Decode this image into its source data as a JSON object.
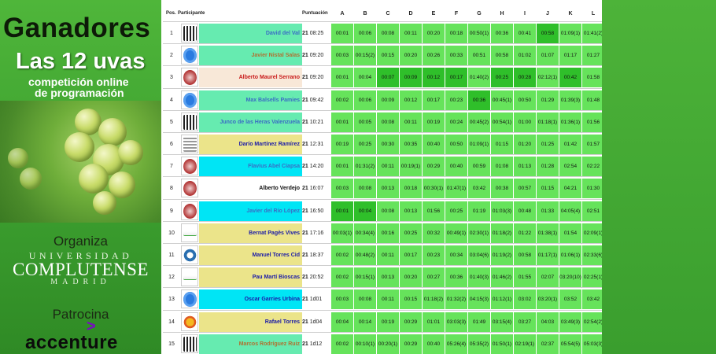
{
  "banner": {
    "title_line1": "Ganadores",
    "title_line2": "Las 12 uvas",
    "subtitle_line1": "competición online",
    "subtitle_line2": "de programación",
    "organiza_label": "Organiza",
    "university_line1": "UNIVERSIDAD",
    "university_line2": "COMPLUTENSE",
    "university_line3": "MADRID",
    "patrocina_label": "Patrocina",
    "sponsor_chevron": ">",
    "sponsor_name": "accenture"
  },
  "colors": {
    "banner_green": "#3c9f2f",
    "cell_green": "#66e35b",
    "cell_dark_green": "#2fbf2a",
    "row_cyan": "#00e5f5",
    "row_yellow": "#ebe48a",
    "row_mint": "#66ebb0",
    "row_peach": "#f8e8d8",
    "accent_purple": "#7a0ac6"
  },
  "table": {
    "headers": {
      "pos": "Pos.",
      "participante": "Participante",
      "puntuacion": "Puntuación",
      "problems": [
        "A",
        "B",
        "C",
        "D",
        "E",
        "F",
        "G",
        "H",
        "I",
        "J",
        "K",
        "L"
      ]
    },
    "rows": [
      {
        "pos": "1",
        "logo": "la-logo",
        "name": "David del Val",
        "name_color": "#3a6cc4",
        "row_bg": "#66ebb0",
        "score": "21",
        "time": "08:25",
        "cells": [
          "00:01",
          "00:06",
          "00:08",
          "00:11",
          "00:20",
          "00:18",
          "00:50(1)",
          "00:36",
          "00:41",
          "00:58",
          "01:09(1)",
          "01:41(2)"
        ],
        "dark": [
          9
        ]
      },
      {
        "pos": "2",
        "logo": "upc-logo",
        "name": "Javier Nistal Salas",
        "name_color": "#b07030",
        "row_bg": "#66ebb0",
        "score": "21",
        "time": "09:20",
        "cells": [
          "00:03",
          "00:15(2)",
          "00:15",
          "00:20",
          "00:26",
          "00:33",
          "00:51",
          "00:58",
          "01:02",
          "01:07",
          "01:17",
          "01:27"
        ],
        "dark": []
      },
      {
        "pos": "3",
        "logo": "ucm-logo",
        "name": "Alberto Maurel Serrano",
        "name_color": "#c81818",
        "row_bg": "#f8e8d8",
        "score": "21",
        "time": "09:20",
        "cells": [
          "00:01",
          "00:04",
          "00:07",
          "00:09",
          "00:12",
          "00:17",
          "01:40(2)",
          "00:25",
          "00:28",
          "02:12(1)",
          "00:42",
          "01:58"
        ],
        "dark": [
          2,
          3,
          4,
          5,
          7,
          8,
          10
        ]
      },
      {
        "pos": "4",
        "logo": "upc-logo",
        "name": "Max Balsells Pamies",
        "name_color": "#3a6cc4",
        "row_bg": "#66ebb0",
        "score": "21",
        "time": "09:42",
        "cells": [
          "00:02",
          "00:06",
          "00:09",
          "00:12",
          "00:17",
          "00:23",
          "00:36",
          "00:45(1)",
          "00:50",
          "01:29",
          "01:39(3)",
          "01:48"
        ],
        "dark": [
          6
        ]
      },
      {
        "pos": "5",
        "logo": "la-logo",
        "name": "Junco de las Heras Valenzuela",
        "name_color": "#3a6cc4",
        "row_bg": "#66ebb0",
        "score": "21",
        "time": "10:21",
        "cells": [
          "00:01",
          "00:05",
          "00:08",
          "00:11",
          "00:19",
          "00:24",
          "00:45(2)",
          "00:54(1)",
          "01:00",
          "01:18(1)",
          "01:36(1)",
          "01:56"
        ],
        "dark": []
      },
      {
        "pos": "6",
        "logo": "building-logo",
        "name": "Darío Martínez Ramírez",
        "name_color": "#1a1aa8",
        "row_bg": "#ebe48a",
        "score": "21",
        "time": "12:31",
        "cells": [
          "00:19",
          "00:25",
          "00:30",
          "00:35",
          "00:40",
          "00:50",
          "01:09(1)",
          "01:15",
          "01:20",
          "01:25",
          "01:42",
          "01:57"
        ],
        "dark": []
      },
      {
        "pos": "7",
        "logo": "ucm-logo",
        "name": "Flavius Abel Ciapsa",
        "name_color": "#3a6cc4",
        "row_bg": "#00e5f5",
        "score": "21",
        "time": "14:20",
        "cells": [
          "00:01",
          "01:31(2)",
          "00:11",
          "00:19(1)",
          "00:29",
          "00:40",
          "00:59",
          "01:08",
          "01:13",
          "01:28",
          "02:54",
          "02:22"
        ],
        "dark": []
      },
      {
        "pos": "8",
        "logo": "ucm-logo",
        "name": "Alberto Verdejo",
        "name_color": "#111111",
        "row_bg": "#ffffff",
        "score": "21",
        "time": "16:07",
        "cells": [
          "00:03",
          "00:08",
          "00:13",
          "00:18",
          "00:30(1)",
          "01:47(1)",
          "03:42",
          "00:38",
          "00:57",
          "01:15",
          "04:21",
          "01:30"
        ],
        "dark": []
      },
      {
        "pos": "9",
        "logo": "ucm-logo",
        "name": "Javier del Río López",
        "name_color": "#3a6cc4",
        "row_bg": "#00e5f5",
        "score": "21",
        "time": "16:50",
        "cells": [
          "00:01",
          "00:04",
          "00:08",
          "00:13",
          "01:56",
          "00:25",
          "01:19",
          "01:03(3)",
          "00:48",
          "01:33",
          "04:05(4)",
          "02:51"
        ],
        "dark": [
          0,
          1
        ]
      },
      {
        "pos": "10",
        "logo": "sin-logo",
        "name": "Bernat Pagès Vives",
        "name_color": "#1a1aa8",
        "row_bg": "#ebe48a",
        "score": "21",
        "time": "17:16",
        "cells": [
          "00:03(1)",
          "00:34(4)",
          "00:16",
          "00:25",
          "00:32",
          "00:49(1)",
          "02:30(1)",
          "01:18(2)",
          "01:22",
          "01:38(1)",
          "01:54",
          "02:09(1)"
        ],
        "dark": []
      },
      {
        "pos": "11",
        "logo": "gear-logo",
        "name": "Manuel Torres Cid",
        "name_color": "#1a1aa8",
        "row_bg": "#ebe48a",
        "score": "21",
        "time": "18:37",
        "cells": [
          "00:02",
          "00:48(2)",
          "00:11",
          "00:17",
          "00:23",
          "00:34",
          "03:04(6)",
          "01:19(2)",
          "00:58",
          "01:17(1)",
          "01:06(1)",
          "02:33(6)"
        ],
        "dark": []
      },
      {
        "pos": "12",
        "logo": "sin-logo",
        "name": "Pau Martí Bioscas",
        "name_color": "#1a1aa8",
        "row_bg": "#ebe48a",
        "score": "21",
        "time": "20:52",
        "cells": [
          "00:02",
          "00:15(1)",
          "00:13",
          "00:20",
          "00:27",
          "00:36",
          "01:40(3)",
          "01:46(2)",
          "01:55",
          "02:07",
          "03:20(10)",
          "02:25(1)"
        ],
        "dark": []
      },
      {
        "pos": "13",
        "logo": "upc-logo",
        "name": "Oscar Garries Urbina",
        "name_color": "#1a1aa8",
        "row_bg": "#00e5f5",
        "score": "21",
        "time": "1d01",
        "cells": [
          "00:03",
          "00:08",
          "00:11",
          "00:15",
          "01:18(2)",
          "01:32(2)",
          "04:15(3)",
          "01:12(1)",
          "03:02",
          "03:20(1)",
          "03:52",
          "03:42"
        ],
        "dark": []
      },
      {
        "pos": "14",
        "logo": "sun-logo",
        "name": "Rafael Torres",
        "name_color": "#1a1aa8",
        "row_bg": "#ebe48a",
        "score": "21",
        "time": "1d04",
        "cells": [
          "00:04",
          "00:14",
          "00:19",
          "00:29",
          "01:01",
          "03:03(3)",
          "01:49",
          "03:15(4)",
          "03:27",
          "04:03",
          "03:49(3)",
          "02:54(2)"
        ],
        "dark": []
      },
      {
        "pos": "15",
        "logo": "la-logo",
        "name": "Marcos Rodríguez Ruiz",
        "name_color": "#b07030",
        "row_bg": "#66ebb0",
        "score": "21",
        "time": "1d12",
        "cells": [
          "00:02",
          "00:10(1)",
          "00:20(1)",
          "00:29",
          "00:40",
          "05:26(4)",
          "05:35(2)",
          "01:50(1)",
          "02:19(1)",
          "02:37",
          "05:54(5)",
          "05:03(3)"
        ],
        "dark": []
      }
    ]
  }
}
